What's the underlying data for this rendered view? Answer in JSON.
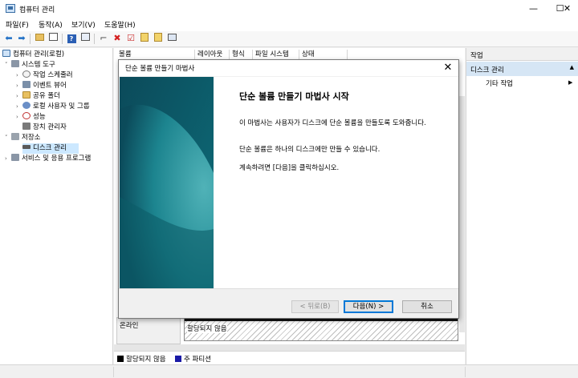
{
  "window": {
    "title": "컴퓨터 관리",
    "minimize_glyph": "—",
    "maximize_glyph": "☐",
    "close_glyph": "✕"
  },
  "menu": [
    "파일(F)",
    "동작(A)",
    "보기(V)",
    "도움말(H)"
  ],
  "tree": {
    "root": "컴퓨터 관리(로컬)",
    "system_tools": "시스템 도구",
    "task_scheduler": "작업 스케줄러",
    "event_viewer": "이벤트 뷰어",
    "shared_folders": "공유 폴더",
    "local_users": "로컬 사용자 및 그룹",
    "performance": "성능",
    "device_manager": "장치 관리자",
    "storage": "저장소",
    "disk_management": "디스크 관리",
    "services_apps": "서비스 및 응용 프로그램"
  },
  "volume_table": {
    "columns": [
      "볼륨",
      "레이아웃",
      "형식",
      "파일 시스템",
      "상태"
    ]
  },
  "disk": {
    "status": "온라인",
    "unallocated_label": "할당되지 않음"
  },
  "legend": [
    {
      "label": "할당되지 않음",
      "color": "#000000"
    },
    {
      "label": "주 파티션",
      "color": "#1a1aa6"
    }
  ],
  "actions": {
    "header": "작업",
    "section": "디스크 관리",
    "other": "기타 작업"
  },
  "dialog": {
    "title": "단순 볼륨 만들기 마법사",
    "heading": "단순 볼륨 만들기 마법사 시작",
    "para1": "이 마법사는 사용자가 디스크에 단순 볼륨을 만들도록 도와줍니다.",
    "para2": "단순 볼륨은 하나의 디스크에만 만들 수 있습니다.",
    "para3": "계속하려면 [다음]을 클릭하십시오.",
    "back_label": "< 뒤로(B)",
    "next_label": "다음(N) >",
    "cancel_label": "취소"
  },
  "colors": {
    "accent": "#0078d7",
    "selection": "#cce8ff",
    "banner_dark": "#0b4a5a",
    "banner_light": "#3aa0a8"
  }
}
